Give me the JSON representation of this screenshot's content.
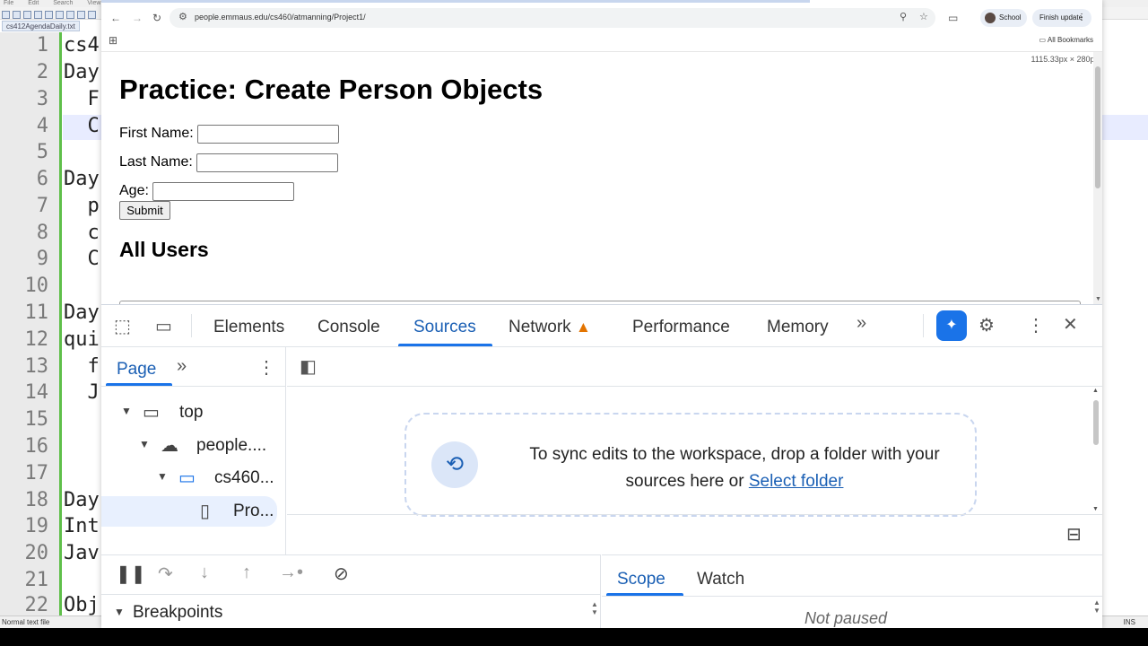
{
  "editor": {
    "file_tab": "cs412AgendaDaily.txt",
    "menu_items": [
      "File",
      "Edit",
      "Search",
      "View"
    ],
    "line_numbers": [
      "1",
      "2",
      "3",
      "4",
      "5",
      "6",
      "7",
      "8",
      "9",
      "10",
      "11",
      "12",
      "13",
      "14",
      "15",
      "16",
      "17",
      "18",
      "19",
      "20",
      "21",
      "22"
    ],
    "code_lines": [
      "cs4",
      "Day",
      "  F",
      "  C",
      "",
      "Day",
      "  p",
      "  c",
      "  C",
      "",
      "Day",
      "qui",
      "  f",
      "  J",
      "",
      "",
      "",
      "Day",
      "Int",
      "Jav",
      "",
      "Obj"
    ],
    "status_left": "Normal text file",
    "status_right": "INS"
  },
  "browser": {
    "url": "people.emmaus.edu/cs460/atmanning/Project1/",
    "profile_label": "School",
    "update_label": "Finish update",
    "bookmarks_label": "All Bookmarks",
    "icons": {
      "back": "arrow-left-icon",
      "forward": "arrow-right-icon",
      "reload": "reload-icon",
      "zoom": "zoom-icon",
      "star": "star-icon",
      "cast": "cast-icon",
      "apps": "apps-grid-icon",
      "folder": "folder-icon"
    }
  },
  "page": {
    "dims_badge": "1115.33px × 280px",
    "title": "Practice: Create Person Objects",
    "first_name_label": "First Name:",
    "first_name_value": "",
    "last_name_label": "Last Name:",
    "last_name_value": "",
    "age_label": "Age:",
    "age_value": "",
    "submit_label": "Submit",
    "all_users_title": "All Users"
  },
  "devtools": {
    "tabs": [
      "Elements",
      "Console",
      "Sources",
      "Network",
      "Performance",
      "Memory"
    ],
    "active_tab": "Sources",
    "warning_color": "#e37400",
    "accent_color": "#1a73e8",
    "nav": {
      "page_tab": "Page",
      "tree": [
        {
          "label": "top",
          "icon": "frame-icon"
        },
        {
          "label": "people....",
          "icon": "cloud-icon"
        },
        {
          "label": "cs460...",
          "icon": "folder-icon"
        },
        {
          "label": "Pro...",
          "icon": "file-icon"
        }
      ]
    },
    "workspace": {
      "message_line1": "To sync edits to the workspace, drop a folder with your",
      "message_line2": "sources here or",
      "select_folder": "Select folder"
    },
    "breakpoints_label": "Breakpoints",
    "scope_tab": "Scope",
    "watch_tab": "Watch",
    "not_paused": "Not paused"
  }
}
